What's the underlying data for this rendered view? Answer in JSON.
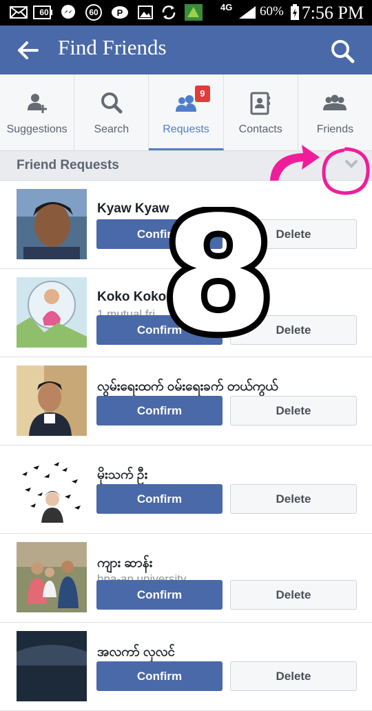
{
  "status_bar": {
    "network": "4G",
    "battery": "60%",
    "time": "7:56 PM",
    "badge_label": "60"
  },
  "app_bar": {
    "title": "Find Friends"
  },
  "tabs": [
    {
      "label": "Suggestions",
      "icon": "add-person-icon"
    },
    {
      "label": "Search",
      "icon": "search-icon"
    },
    {
      "label": "Requests",
      "icon": "friends-icon",
      "badge": "9",
      "active": true
    },
    {
      "label": "Contacts",
      "icon": "contacts-book-icon"
    },
    {
      "label": "Friends",
      "icon": "group-icon"
    }
  ],
  "section": {
    "title": "Friend Requests"
  },
  "requests": [
    {
      "name": "Kyaw Kyaw",
      "sub": "",
      "confirm": "Confirm",
      "delete": "Delete"
    },
    {
      "name": "Koko Koko",
      "sub": "1 mutual fri",
      "confirm": "Confirm",
      "delete": "Delete"
    },
    {
      "name": "လွမ်းရေးထက် ဝမ်းရေးခက် တယ်ကွယ်",
      "sub": "",
      "confirm": "Confirm",
      "delete": "Delete"
    },
    {
      "name": "မိုးသက် ဦး",
      "sub": "",
      "confirm": "Confirm",
      "delete": "Delete"
    },
    {
      "name": "ကျား ဆာန်း",
      "sub": "hpa-an university",
      "confirm": "Confirm",
      "delete": "Delete"
    },
    {
      "name": "အလကာ် လှလင်",
      "sub": "",
      "confirm": "Confirm",
      "delete": "Delete"
    }
  ],
  "annotation": {
    "number": "8"
  },
  "colors": {
    "brand": "#4a69a9",
    "active_tab": "#4f7dcb",
    "badge": "#e23b3b",
    "annotation": "#f01d9a"
  }
}
